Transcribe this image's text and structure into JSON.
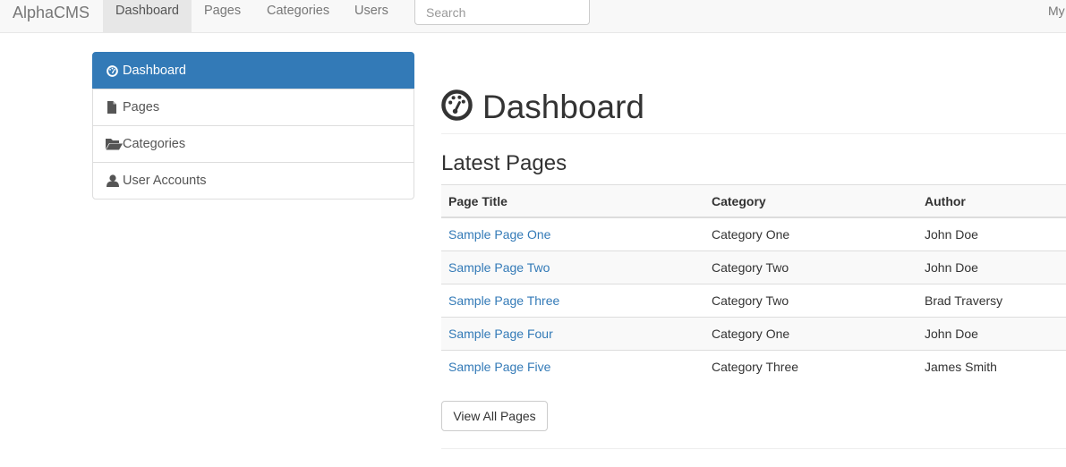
{
  "navbar": {
    "brand": "AlphaCMS",
    "links": [
      {
        "label": "Dashboard",
        "active": true
      },
      {
        "label": "Pages",
        "active": false
      },
      {
        "label": "Categories",
        "active": false
      },
      {
        "label": "Users",
        "active": false
      }
    ],
    "search_placeholder": "Search",
    "right_text": "My"
  },
  "sidebar": {
    "items": [
      {
        "label": "Dashboard",
        "icon": "dashboard-icon",
        "active": true
      },
      {
        "label": "Pages",
        "icon": "file-icon",
        "active": false
      },
      {
        "label": "Categories",
        "icon": "folder-open-icon",
        "active": false
      },
      {
        "label": "User Accounts",
        "icon": "user-icon",
        "active": false
      }
    ]
  },
  "main": {
    "title": "Dashboard",
    "title_icon": "dashboard-icon",
    "section_title": "Latest Pages",
    "table": {
      "headers": [
        "Page Title",
        "Category",
        "Author"
      ],
      "rows": [
        [
          "Sample Page One",
          "Category One",
          "John Doe"
        ],
        [
          "Sample Page Two",
          "Category Two",
          "John Doe"
        ],
        [
          "Sample Page Three",
          "Category Two",
          "Brad Traversy"
        ],
        [
          "Sample Page Four",
          "Category One",
          "John Doe"
        ],
        [
          "Sample Page Five",
          "Category Three",
          "James Smith"
        ]
      ]
    },
    "view_all_label": "View All Pages"
  },
  "colors": {
    "primary": "#337ab7",
    "navbar_bg": "#f8f8f8",
    "link": "#337ab7"
  }
}
